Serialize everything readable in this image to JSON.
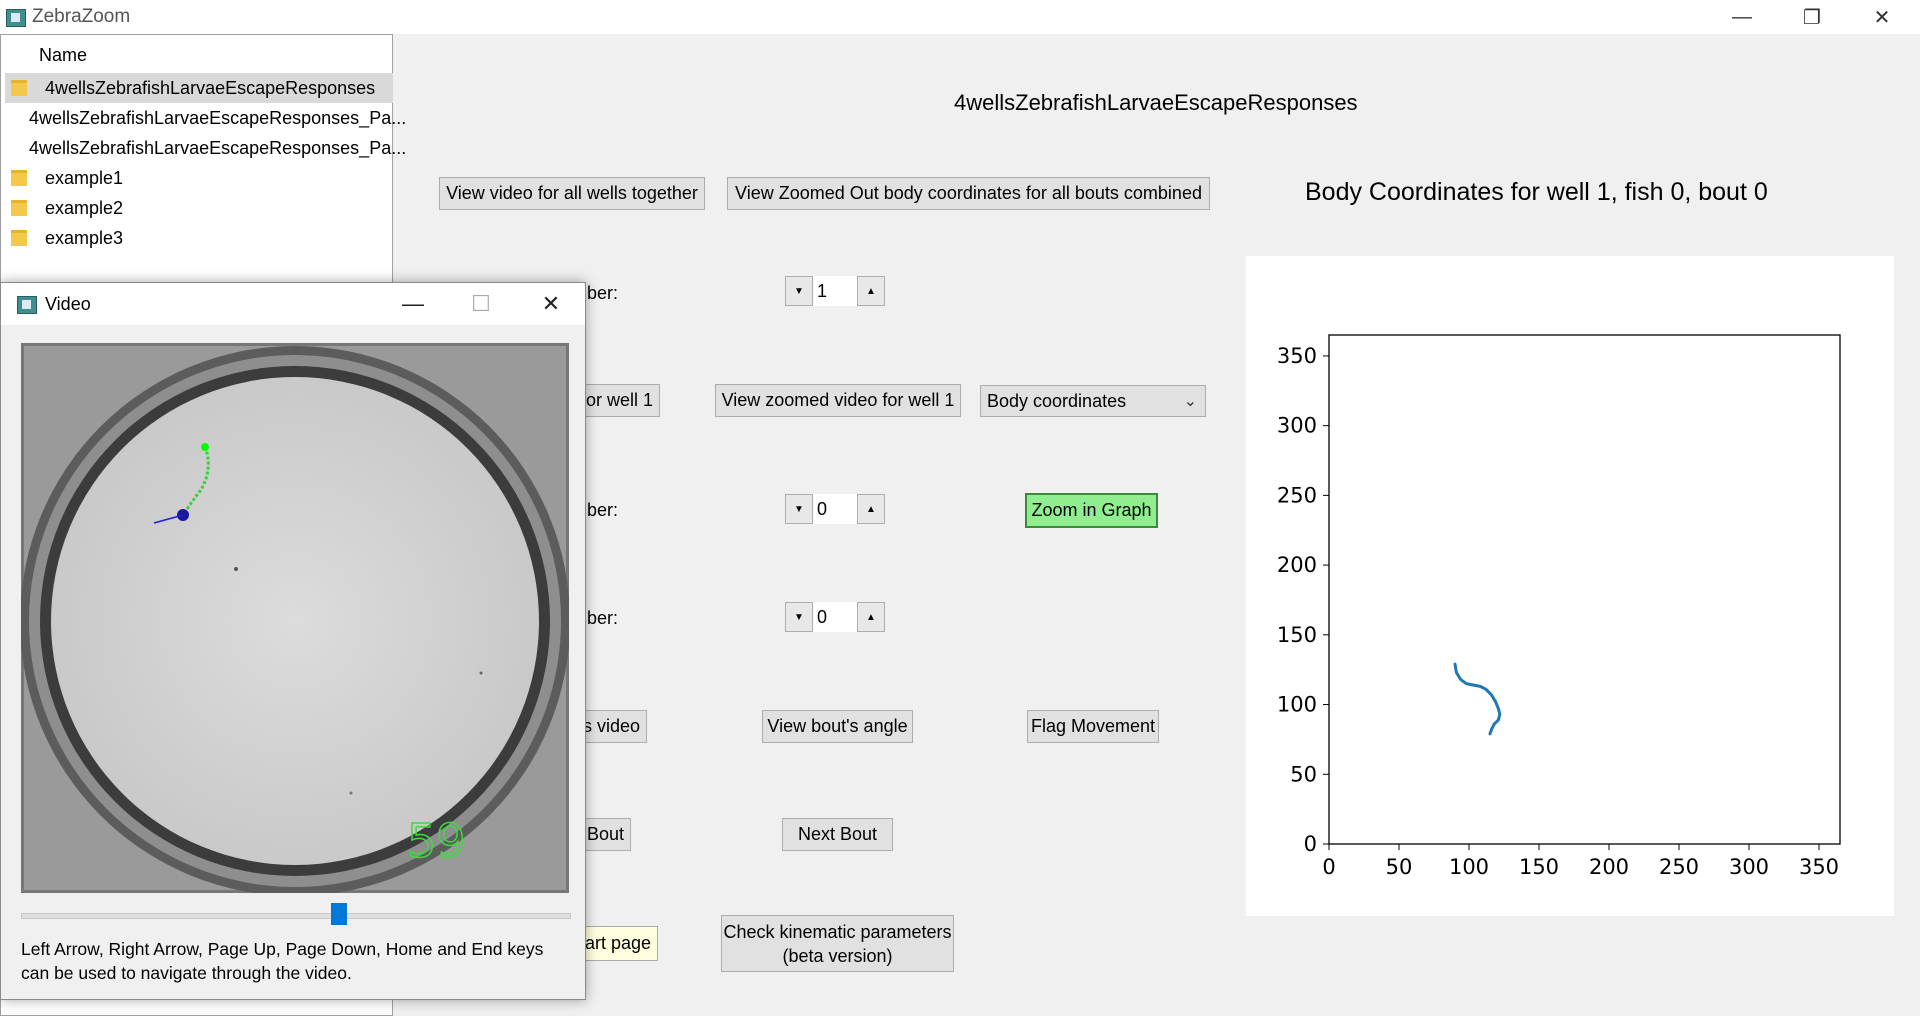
{
  "app": {
    "title": "ZebraZoom"
  },
  "filelist": {
    "column_header": "Name",
    "items": [
      {
        "label": "4wellsZebrafishLarvaeEscapeResponses"
      },
      {
        "label": "4wellsZebrafishLarvaeEscapeResponses_Pa..."
      },
      {
        "label": "4wellsZebrafishLarvaeEscapeResponses_Pa..."
      },
      {
        "label": "example1"
      },
      {
        "label": "example2"
      },
      {
        "label": "example3"
      }
    ],
    "selected_index": 0
  },
  "main": {
    "title": "4wellsZebrafishLarvaeEscapeResponses",
    "buttons": {
      "view_all_wells": "View video for all wells together",
      "view_zoomed_out": "View Zoomed Out body coordinates for all bouts combined",
      "view_video_well_partial": "or well 1",
      "view_zoomed_video_well": "View zoomed video for well 1",
      "zoom_in_graph": "Zoom in Graph",
      "bout_video_partial": "s video",
      "view_bout_angle": "View bout's angle",
      "flag_movement": "Flag Movement",
      "prev_bout_partial": "Bout",
      "next_bout": "Next Bout",
      "start_page_partial": "art page",
      "check_kinematic": "Check kinematic parameters",
      "check_kinematic_sub": "(beta version)"
    },
    "labels": {
      "well_number_partial": "nber:",
      "fish_number_partial": "nber:",
      "bout_number_partial": "nber:"
    },
    "spinners": {
      "well": "1",
      "fish": "0",
      "bout": "0"
    },
    "graph_select": {
      "value": "Body coordinates"
    }
  },
  "plot": {
    "title": "Body Coordinates for well 1, fish 0, bout 0"
  },
  "chart_data": {
    "type": "line",
    "title": "Body Coordinates for well 1, fish 0, bout 0",
    "xlabel": "",
    "ylabel": "",
    "xlim": [
      0,
      365
    ],
    "ylim": [
      0,
      365
    ],
    "xticks": [
      0,
      50,
      100,
      150,
      200,
      250,
      300,
      350
    ],
    "yticks": [
      0,
      50,
      100,
      150,
      200,
      250,
      300,
      350
    ],
    "grid": false,
    "color": "#1f77b4",
    "series": [
      {
        "x": [
          90,
          91,
          94,
          98,
          103,
          108,
          112,
          116,
          119,
          121,
          122,
          121,
          118,
          116,
          115
        ],
        "y": [
          129,
          123,
          118,
          115,
          114,
          113,
          111,
          107,
          102,
          97,
          93,
          89,
          86,
          82,
          79
        ]
      }
    ]
  },
  "video_window": {
    "title": "Video",
    "frame_number": "59",
    "slider_value": 0.58,
    "help_text_line1": "Left Arrow, Right Arrow, Page Up, Page Down, Home and End keys",
    "help_text_line2": "can be used to navigate through the video."
  },
  "colors": {
    "accent": "#0078d7",
    "green_button": "#90ee90",
    "plot_line": "#1f77b4",
    "overlay_green": "#00ff00"
  }
}
